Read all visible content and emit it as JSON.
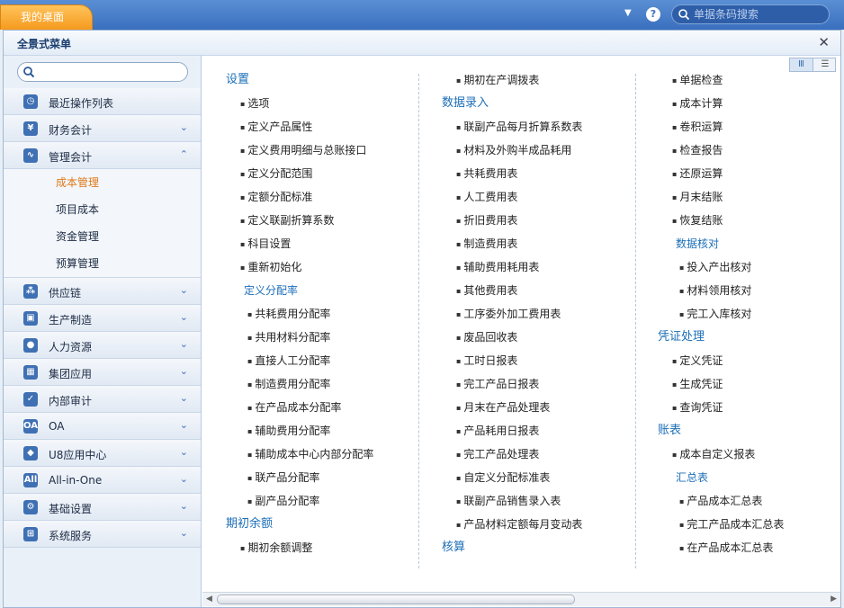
{
  "topbar": {
    "desktop_tab": "我的桌面",
    "search_placeholder": "单据条码搜索",
    "help_glyph": "?",
    "caret_glyph": "▼"
  },
  "panel": {
    "title": "全景式菜单",
    "close_glyph": "✕"
  },
  "sidebar": {
    "search_placeholder": "",
    "items": [
      {
        "label": "最近操作列表",
        "icon": "clock-icon",
        "glyph": "◷",
        "chev": ""
      },
      {
        "label": "财务会计",
        "icon": "yen-icon",
        "glyph": "¥",
        "chev": "⌄"
      },
      {
        "label": "管理会计",
        "icon": "chart-line-icon",
        "glyph": "∿",
        "chev": "⌃"
      },
      {
        "label": "供应链",
        "icon": "network-icon",
        "glyph": "⁂",
        "chev": "⌄"
      },
      {
        "label": "生产制造",
        "icon": "machine-icon",
        "glyph": "▣",
        "chev": "⌄"
      },
      {
        "label": "人力资源",
        "icon": "person-icon",
        "glyph": "●",
        "chev": "⌄"
      },
      {
        "label": "集团应用",
        "icon": "grid-icon",
        "glyph": "▦",
        "chev": "⌄"
      },
      {
        "label": "内部审计",
        "icon": "checklist-icon",
        "glyph": "✓",
        "chev": "⌄"
      },
      {
        "label": "OA",
        "icon": "oa-icon",
        "glyph": "OA",
        "chev": "⌄"
      },
      {
        "label": "U8应用中心",
        "icon": "cube-icon",
        "glyph": "◆",
        "chev": "⌄"
      },
      {
        "label": "All-in-One",
        "icon": "all-icon",
        "glyph": "All",
        "chev": "⌄"
      },
      {
        "label": "基础设置",
        "icon": "gear-icon",
        "glyph": "⚙",
        "chev": "⌄"
      },
      {
        "label": "系统服务",
        "icon": "service-icon",
        "glyph": "⊞",
        "chev": "⌄"
      }
    ],
    "sub_items": [
      "成本管理",
      "项目成本",
      "资金管理",
      "预算管理"
    ]
  },
  "view_toggle": {
    "columns_glyph": "Ⅲ",
    "list_glyph": "☰"
  },
  "columns": [
    [
      {
        "t": "head",
        "text": "设置"
      },
      {
        "t": "item",
        "text": "选项"
      },
      {
        "t": "item",
        "text": "定义产品属性"
      },
      {
        "t": "item",
        "text": "定义费用明细与总账接口"
      },
      {
        "t": "item",
        "text": "定义分配范围"
      },
      {
        "t": "item",
        "text": "定额分配标准"
      },
      {
        "t": "item",
        "text": "定义联副折算系数"
      },
      {
        "t": "item",
        "text": "科目设置"
      },
      {
        "t": "item",
        "text": "重新初始化"
      },
      {
        "t": "subhead",
        "text": "定义分配率"
      },
      {
        "t": "item2",
        "text": "共耗费用分配率"
      },
      {
        "t": "item2",
        "text": "共用材料分配率"
      },
      {
        "t": "item2",
        "text": "直接人工分配率"
      },
      {
        "t": "item2",
        "text": "制造费用分配率"
      },
      {
        "t": "item2",
        "text": "在产品成本分配率"
      },
      {
        "t": "item2",
        "text": "辅助费用分配率"
      },
      {
        "t": "item2",
        "text": "辅助成本中心内部分配率"
      },
      {
        "t": "item2",
        "text": "联产品分配率"
      },
      {
        "t": "item2",
        "text": "副产品分配率"
      },
      {
        "t": "head",
        "text": "期初余额"
      },
      {
        "t": "item",
        "text": "期初余额调整"
      }
    ],
    [
      {
        "t": "item",
        "text": "期初在产调拨表"
      },
      {
        "t": "head",
        "text": "数据录入"
      },
      {
        "t": "item",
        "text": "联副产品每月折算系数表"
      },
      {
        "t": "item",
        "text": "材料及外购半成品耗用"
      },
      {
        "t": "item",
        "text": "共耗费用表"
      },
      {
        "t": "item",
        "text": "人工费用表"
      },
      {
        "t": "item",
        "text": "折旧费用表"
      },
      {
        "t": "item",
        "text": "制造费用表"
      },
      {
        "t": "item",
        "text": "辅助费用耗用表"
      },
      {
        "t": "item",
        "text": "其他费用表"
      },
      {
        "t": "item",
        "text": "工序委外加工费用表"
      },
      {
        "t": "item",
        "text": "废品回收表"
      },
      {
        "t": "item",
        "text": "工时日报表"
      },
      {
        "t": "item",
        "text": "完工产品日报表"
      },
      {
        "t": "item",
        "text": "月末在产品处理表"
      },
      {
        "t": "item",
        "text": "产品耗用日报表"
      },
      {
        "t": "item",
        "text": "完工产品处理表"
      },
      {
        "t": "item",
        "text": "自定义分配标准表"
      },
      {
        "t": "item",
        "text": "联副产品销售录入表"
      },
      {
        "t": "item",
        "text": "产品材料定额每月变动表"
      },
      {
        "t": "head",
        "text": "核算"
      }
    ],
    [
      {
        "t": "item",
        "text": "单据检查"
      },
      {
        "t": "item",
        "text": "成本计算"
      },
      {
        "t": "item",
        "text": "卷积运算"
      },
      {
        "t": "item",
        "text": "检查报告"
      },
      {
        "t": "item",
        "text": "还原运算"
      },
      {
        "t": "item",
        "text": "月末结账"
      },
      {
        "t": "item",
        "text": "恢复结账"
      },
      {
        "t": "subhead",
        "text": "数据核对"
      },
      {
        "t": "item2",
        "text": "投入产出核对"
      },
      {
        "t": "item2",
        "text": "材料领用核对"
      },
      {
        "t": "item2",
        "text": "完工入库核对"
      },
      {
        "t": "head",
        "text": "凭证处理"
      },
      {
        "t": "item",
        "text": "定义凭证"
      },
      {
        "t": "item",
        "text": "生成凭证"
      },
      {
        "t": "item",
        "text": "查询凭证"
      },
      {
        "t": "head",
        "text": "账表"
      },
      {
        "t": "item",
        "text": "成本自定义报表"
      },
      {
        "t": "subhead",
        "text": "汇总表"
      },
      {
        "t": "item2",
        "text": "产品成本汇总表"
      },
      {
        "t": "item2",
        "text": "完工产品成本汇总表"
      },
      {
        "t": "item2",
        "text": "在产品成本汇总表"
      }
    ]
  ],
  "scrollbar": {
    "left_glyph": "◀",
    "right_glyph": "▶"
  }
}
